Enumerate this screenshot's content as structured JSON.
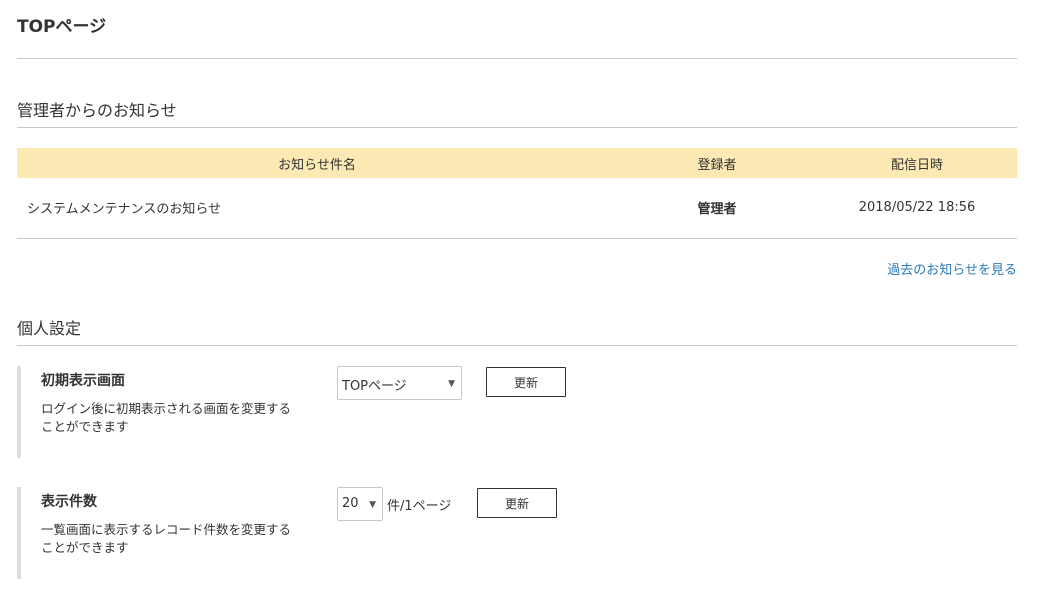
{
  "page": {
    "title": "TOPページ"
  },
  "notices": {
    "section_title": "管理者からのお知らせ",
    "columns": {
      "subject": "お知らせ件名",
      "author": "登録者",
      "date": "配信日時"
    },
    "rows": [
      {
        "subject": "システムメンテナンスのお知らせ",
        "author": "管理者",
        "date": "2018/05/22 18:56"
      }
    ],
    "more_link": "過去のお知らせを見る"
  },
  "personal": {
    "section_title": "個人設定",
    "initial_screen": {
      "title": "初期表示画面",
      "description": "ログイン後に初期表示される画面を変更することができます",
      "selected": "TOPページ",
      "button": "更新"
    },
    "display_count": {
      "title": "表示件数",
      "description": "一覧画面に表示するレコード件数を変更することができます",
      "selected": "20",
      "unit": "件/1ページ",
      "button": "更新"
    }
  },
  "colors": {
    "table_header_bg": "#fde9b3",
    "link": "#2b7ab7",
    "rule": "#c8c8c8"
  }
}
